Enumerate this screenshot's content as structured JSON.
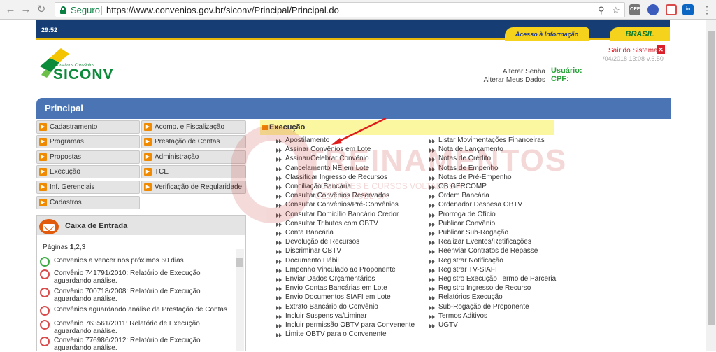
{
  "browser": {
    "secure_label": "Seguro",
    "url": "https://www.convenios.gov.br/siconv/Principal/Principal.do",
    "ext_off": "OFF"
  },
  "header": {
    "clock": "29:52",
    "acesso": "Acesso à Informação",
    "brasil": "BRASIL"
  },
  "logo": {
    "subtitle": "Portal dos Convênios",
    "name": "SICONV"
  },
  "session": {
    "sair": "Sair do Sistema",
    "version": "/04/2018 13:08-v.6.50",
    "alterar_senha": "Alterar Senha",
    "alterar_dados": "Alterar Meus Dados",
    "usuario": "Usuário:",
    "cpf": "CPF:"
  },
  "principal": {
    "title": "Principal"
  },
  "menu": [
    "Cadastramento",
    "Acomp. e Fiscalização",
    "Programas",
    "Prestação de Contas",
    "Propostas",
    "Administração",
    "Execução",
    "TCE",
    "Inf. Gerenciais",
    "Verificação de Regularidade",
    "Cadastros"
  ],
  "inbox": {
    "title": "Caixa de Entrada",
    "pages_prefix": "Páginas ",
    "pages_current": "1",
    "pages_rest": ",2,3",
    "messages": [
      {
        "text": "Convenios a vencer nos próximos 60 dias",
        "icon": "clock-ok-icon"
      },
      {
        "text": "Convênio 741791/2010: Relatório de Execução aguardando análise.",
        "icon": "alert-icon"
      },
      {
        "text": "Convênio 700718/2008: Relatório de Execução aguardando análise.",
        "icon": "alert-icon"
      },
      {
        "text": "Convênios aguardando análise da Prestação de Contas",
        "icon": "alert-icon"
      },
      {
        "text": "Convênio 763561/2011: Relatório de Execução aguardando análise.",
        "icon": "alert-icon"
      },
      {
        "text": "Convênio 776986/2012: Relatório de Execução aguardando análise.",
        "icon": "alert-icon"
      }
    ]
  },
  "execucao": {
    "title": "Execução",
    "col1": [
      "Apostilamento",
      "Assinar Convênios em Lote",
      "Assinar/Celebrar Convênio",
      "Cancelamento NE em Lote",
      "Classificar Ingresso de Recursos",
      "Conciliação Bancária",
      "Consultar Convênios Reservados",
      "Consultar Convênios/Pré-Convênios",
      "Consultar Domicílio Bancário Credor",
      "Consultar Tributos com OBTV",
      "Conta Bancária",
      "Devolução de Recursos",
      "Discriminar OBTV",
      "Documento Hábil",
      "Empenho Vinculado ao Proponente",
      "Enviar Dados Orçamentários",
      "Envio Contas Bancárias em Lote",
      "Envio Documentos SIAFI em Lote",
      "Extrato Bancário do Convênio",
      "Incluir Suspensiva/Liminar",
      "Incluir permissão OBTV para Convenente",
      "Limite OBTV para o Convenente"
    ],
    "col2": [
      "Listar Movimentações Financeiras",
      "Nota de Lançamento",
      "Notas de Crédito",
      "Notas de Empenho",
      "Notas de Pré-Empenho",
      "OB GERCOMP",
      "Ordem Bancária",
      "Ordenador Despesa OBTV",
      "Prorroga de Ofício",
      "Publicar Convênio",
      "Publicar Sub-Rogação",
      "Realizar Eventos/Retificações",
      "Reenviar Contratos de Repasse",
      "Registrar Notificação",
      "Registrar TV-SIAFI",
      "Registro Execução Termo de Parceria",
      "Registro Ingresso de Recurso",
      "Relatórios Execução",
      "Sub-Rogação de Proponente",
      "Termos Aditivos",
      "UGTV"
    ]
  },
  "watermark": {
    "big": "TREINAMENTOS",
    "small": "SOLUÇÕES E CURSOS VOLTADOS À GESTÃO PÚBLICA"
  }
}
